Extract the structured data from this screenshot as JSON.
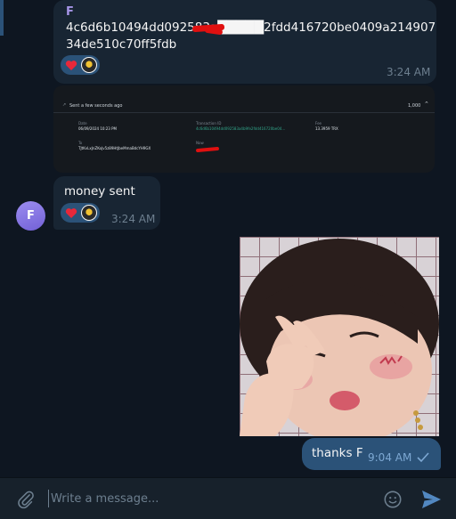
{
  "messages": {
    "hash_message": {
      "sender_initial": "F",
      "text": "4c6d6b10494dd092583a█████2fdd416720be0409a21490734de510c70ff5fdb",
      "time": "3:24 AM"
    },
    "screenshot": {
      "status": "Sent a few seconds ago",
      "amount_top": "1,000",
      "date_label": "Date",
      "date_value": "06/09/2024 10:23 PM",
      "txid_label": "Transaction ID",
      "txid_value": "4c6d6b10494dd092583a4b9fe2fdd416720be04…",
      "fee_label": "Fee",
      "fee_value": "13.3959 TRX",
      "to_label": "To",
      "to_value": "TJtKvLxJnZKoJv5z89HtJbeMmaBdcYH9GX",
      "now_label": "Now"
    },
    "money_sent": {
      "text": "money sent",
      "time": "3:24 AM",
      "avatar_initial": "F"
    },
    "outgoing": {
      "text": "thanks F",
      "time": "9:04 AM"
    }
  },
  "composer": {
    "placeholder": "Write a message..."
  },
  "colors": {
    "background": "#0e1621",
    "incoming_bubble": "#182533",
    "outgoing_bubble": "#2b5278",
    "accent": "#5288c1",
    "muted_text": "#6d7f8f",
    "sender_name": "#a695e7"
  },
  "icons": {
    "reaction_1": "heart-icon",
    "reaction_2": "reactor-avatar",
    "attach": "paperclip-icon",
    "emoji": "emoji-icon",
    "send": "send-icon",
    "read": "check-icon",
    "collapse": "chevron-up-icon"
  }
}
